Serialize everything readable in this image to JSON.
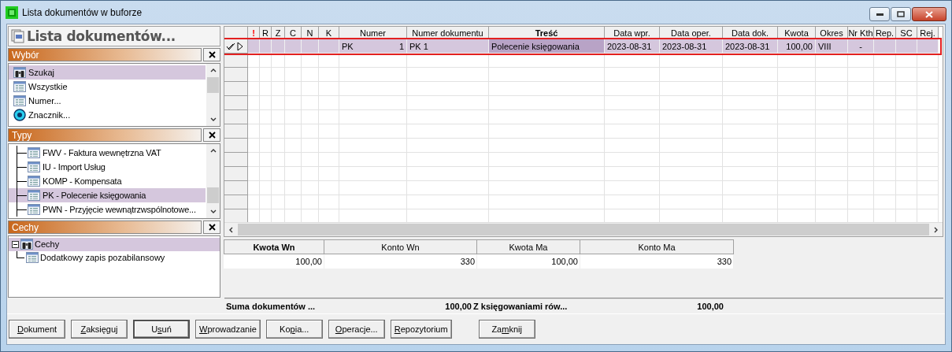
{
  "window": {
    "title": "Lista dokumentów w buforze"
  },
  "left_panel": {
    "title": "Lista dokumentów...",
    "wybor": {
      "title": "Wybór",
      "items": [
        {
          "label": "Szukaj",
          "kind": "search",
          "selected": true
        },
        {
          "label": "Wszystkie",
          "kind": "list",
          "selected": false
        },
        {
          "label": "Numer...",
          "kind": "list",
          "selected": false
        },
        {
          "label": "Znacznik...",
          "kind": "marker",
          "selected": false
        }
      ]
    },
    "typy": {
      "title": "Typy",
      "items": [
        {
          "label": "FWV - Faktura wewnętrzna VAT",
          "selected": false
        },
        {
          "label": "IU - Import Usług",
          "selected": false
        },
        {
          "label": "KOMP - Kompensata",
          "selected": false
        },
        {
          "label": "PK - Polecenie księgowania",
          "selected": true
        },
        {
          "label": "PWN - Przyjęcie wewnątrzwspólnotowe...",
          "selected": false
        }
      ]
    },
    "cechy": {
      "title": "Cechy",
      "items": [
        {
          "label": "Cechy",
          "kind": "search",
          "expanded": true,
          "selected": true,
          "children": [
            {
              "label": "Dodatkowy zapis pozabilansowy",
              "kind": "list",
              "selected": false
            }
          ]
        }
      ]
    }
  },
  "documents": {
    "columns": [
      {
        "label": "!",
        "kind": "flag",
        "sorted": false
      },
      {
        "label": "R",
        "sorted": false
      },
      {
        "label": "Z",
        "sorted": false
      },
      {
        "label": "C",
        "sorted": false
      },
      {
        "label": "N",
        "sorted": false
      },
      {
        "label": "K",
        "sorted": false
      },
      {
        "label": "Numer",
        "sorted": false
      },
      {
        "label": "Numer dokumentu",
        "sorted": false
      },
      {
        "label": "Treść",
        "sorted": true
      },
      {
        "label": "Data wpr.",
        "sorted": false
      },
      {
        "label": "Data oper.",
        "sorted": false
      },
      {
        "label": "Data dok.",
        "sorted": false
      },
      {
        "label": "Kwota",
        "sorted": false
      },
      {
        "label": "Okres",
        "sorted": false
      },
      {
        "label": "Nr Kth",
        "sorted": false
      },
      {
        "label": "Rep.",
        "sorted": false
      },
      {
        "label": "SC",
        "sorted": false
      },
      {
        "label": "Rej.",
        "sorted": false
      }
    ],
    "rows": [
      {
        "selected": true,
        "current": true,
        "cells": [
          {
            "focused": false
          },
          {
            "focused": false
          },
          {
            "focused": false
          },
          {
            "focused": false
          },
          {
            "focused": false
          },
          {
            "focused": false
          },
          {
            "prefix": "PK",
            "text": "1",
            "focused": false
          },
          {
            "text": "PK 1",
            "focused": false
          },
          {
            "text": "Polecenie księgowania",
            "focused": true
          },
          {
            "text": "2023-08-31",
            "focused": false
          },
          {
            "text": "2023-08-31",
            "focused": false
          },
          {
            "text": "2023-08-31",
            "focused": false
          },
          {
            "text": "100,00",
            "focused": false
          },
          {
            "text": "VIII",
            "focused": false
          },
          {
            "text": "-",
            "focused": false
          },
          {
            "focused": false
          },
          {
            "focused": false
          },
          {
            "focused": false
          }
        ]
      }
    ]
  },
  "postings": {
    "columns": [
      {
        "label": "Kwota Wn",
        "sorted": true
      },
      {
        "label": "Konto Wn",
        "sorted": false
      },
      {
        "label": "Kwota Ma",
        "sorted": false
      },
      {
        "label": "Konto Ma",
        "sorted": false
      }
    ],
    "rows": [
      [
        "100,00",
        "330",
        "100,00",
        "330"
      ]
    ]
  },
  "summary": [
    {
      "label": "Suma dokumentów ...",
      "value": "100,00"
    },
    {
      "label": "Z księgowaniami rów...",
      "value": "100,00"
    }
  ],
  "buttons": [
    {
      "key": "D",
      "after": "okument",
      "default": false
    },
    {
      "key": "Z",
      "after": "aksięguj",
      "default": false
    },
    {
      "before": "U",
      "key": "s",
      "after": "uń",
      "default": true
    },
    {
      "key": "W",
      "after": "prowadzanie",
      "default": false
    },
    {
      "before": "Ko",
      "key": "p",
      "after": "ia...",
      "default": false
    },
    {
      "key": "O",
      "after": "peracje...",
      "default": false
    },
    {
      "key": "R",
      "after": "epozytorium",
      "default": false
    },
    {
      "before": "Za",
      "key": "m",
      "after": "knij",
      "default": false
    }
  ]
}
